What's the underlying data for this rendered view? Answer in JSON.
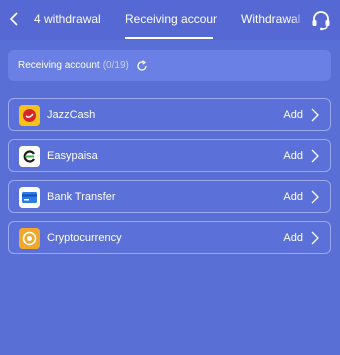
{
  "header": {
    "tabs": [
      {
        "label": "4 withdrawal"
      },
      {
        "label": "Receiving account"
      },
      {
        "label": "Withdrawal l"
      }
    ],
    "active_tab": "Receiving account"
  },
  "account_bar": {
    "label": "Receiving account",
    "count": "(0/19)"
  },
  "methods": [
    {
      "name": "JazzCash",
      "action": "Add"
    },
    {
      "name": "Easypaisa",
      "action": "Add"
    },
    {
      "name": "Bank Transfer",
      "action": "Add"
    },
    {
      "name": "Cryptocurrency",
      "action": "Add"
    }
  ],
  "colors": {
    "background": "#5a6fd6",
    "topbar": "#5568d3",
    "accent_border": "#9aa8ee"
  }
}
